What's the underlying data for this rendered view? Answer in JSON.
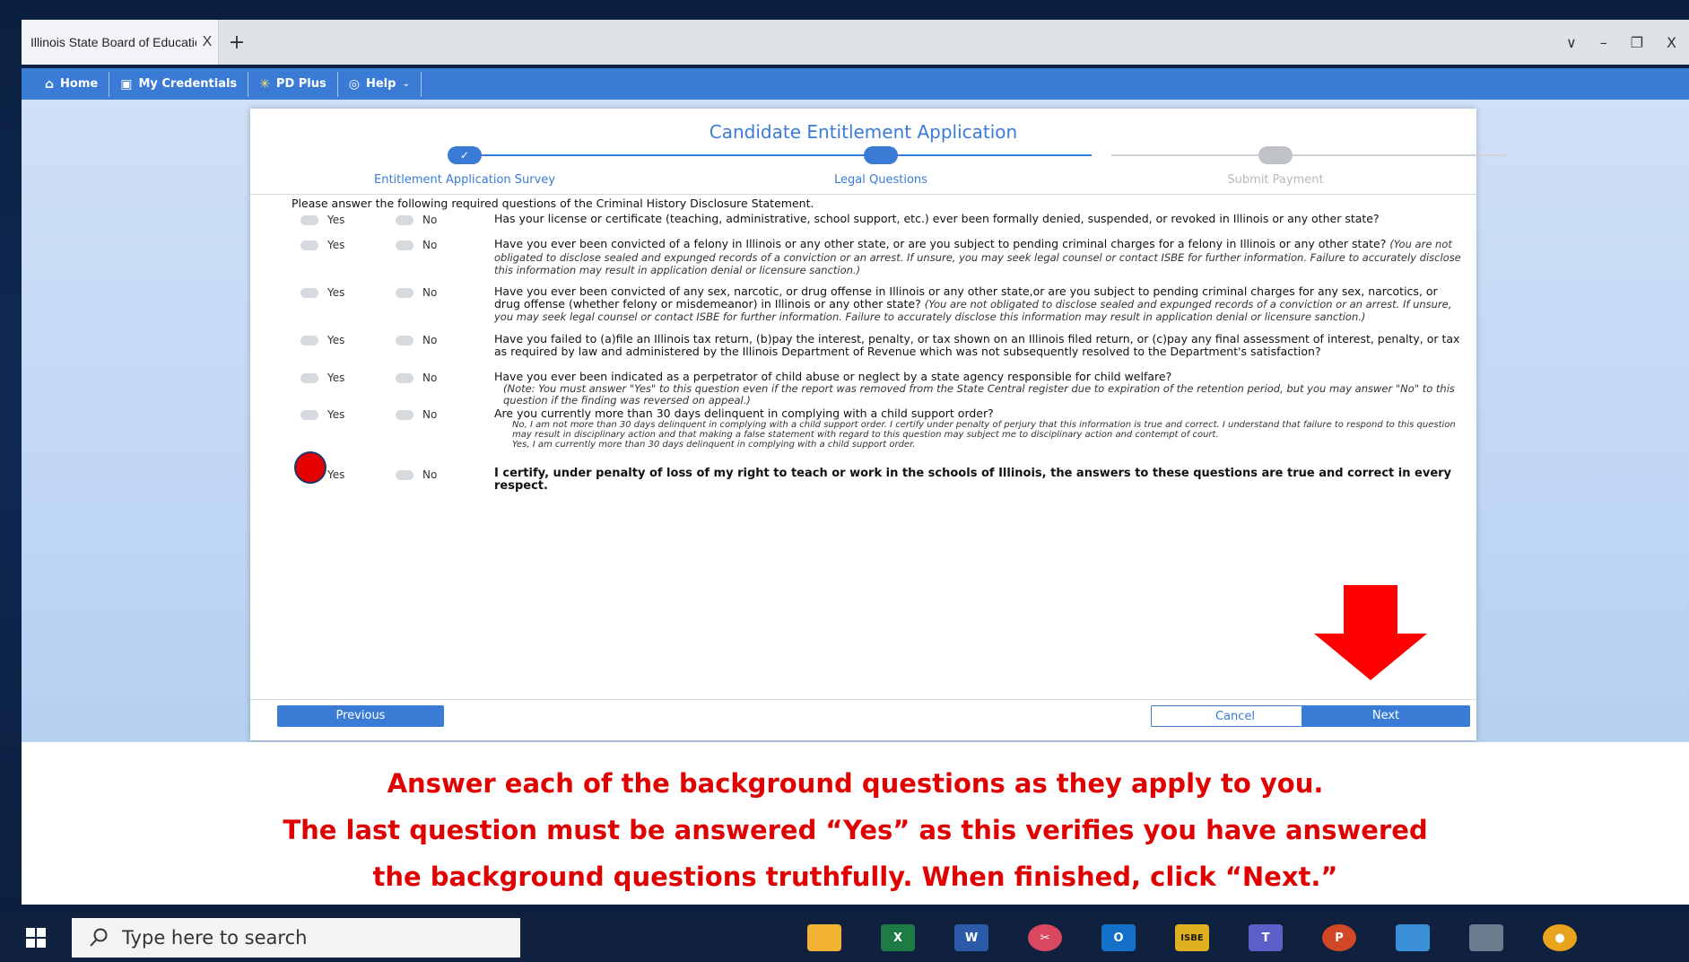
{
  "browser": {
    "tab_title": "Illinois State Board of Education",
    "tab_close": "X",
    "new_tab": "+",
    "win_chevron": "∨",
    "win_minimize": "–",
    "win_restore": "❐",
    "win_close": "X"
  },
  "nav": {
    "items": [
      {
        "label": "Home",
        "icon": "home-icon"
      },
      {
        "label": "My Credentials",
        "icon": "credentials-icon"
      },
      {
        "label": "PD Plus",
        "icon": "pd-plus-icon"
      },
      {
        "label": "Help",
        "icon": "help-icon"
      }
    ]
  },
  "card": {
    "title": "Candidate Entitlement Application",
    "steps": [
      {
        "label": "Entitlement Application Survey",
        "state": "complete"
      },
      {
        "label": "Legal Questions",
        "state": "current"
      },
      {
        "label": "Submit Payment",
        "state": "pending"
      }
    ],
    "intro": "Please answer the following required questions of the Criminal History Disclosure Statement.",
    "yes_label": "Yes",
    "no_label": "No",
    "questions": [
      {
        "text": "Has your license or certificate (teaching, administrative, school support, etc.) ever been formally denied, suspended, or revoked in Illinois or any other state?"
      },
      {
        "text": "Have you ever been convicted of a felony in Illinois or any other state, or are you subject to pending criminal charges for a felony in Illinois or any other state?",
        "note": "(You are not obligated to disclose sealed and expunged records of a conviction or an arrest. If unsure, you may seek legal counsel or contact ISBE for further information. Failure to accurately disclose this information may result in application denial or licensure sanction.)"
      },
      {
        "text": "Have you ever been convicted of any sex, narcotic, or drug offense in Illinois or any other state,or are you subject to pending criminal charges for any sex, narcotics, or drug offense (whether felony or misdemeanor) in Illinois or any other state?",
        "note": "(You are not obligated to disclose sealed and expunged records of a conviction or an arrest. If unsure, you may seek legal counsel or contact ISBE for further information. Failure to accurately disclose this information may result in application denial or licensure sanction.)"
      },
      {
        "text": "Have you failed to (a)file an Illinois tax return, (b)pay the interest, penalty, or tax shown on an Illinois filed return, or (c)pay any final assessment of interest, penalty, or tax as required by law and administered by the Illinois Department of Revenue which was not subsequently resolved to the Department's satisfaction?"
      },
      {
        "text": "Have you ever been indicated as a perpetrator of child abuse or neglect by a state agency responsible for child welfare?",
        "note": "(Note: You must answer \"Yes\" to this question even if the report was removed from the State Central register due to expiration of the retention period, but you may answer \"No\" to this question if the finding was reversed on appeal.)"
      },
      {
        "text": "Are you currently more than 30 days delinquent in complying with a child support order?",
        "subnotes": [
          "No, I am not more than 30 days delinquent in complying with a child support order. I certify under penalty of perjury that this information is true and correct. I understand that failure to respond to this question may result in disciplinary action and that making a false statement with regard to this question may subject me to disciplinary action and contempt of court.",
          "Yes, I am currently more than 30 days delinquent in complying with a child support order."
        ]
      },
      {
        "text": "I certify, under penalty of loss of my right to teach or work in the schools of Illinois, the answers to these questions are true and correct in every respect."
      }
    ],
    "buttons": {
      "previous": "Previous",
      "cancel": "Cancel",
      "next": "Next"
    }
  },
  "instructions": {
    "line1": "Answer each of the background questions as they apply to you.",
    "line2": "The last question must be answered “Yes” as this verifies you have answered",
    "line3": "the background questions truthfully.   When finished, click “Next.”"
  },
  "taskbar": {
    "search_placeholder": "Type here to search",
    "apps": [
      "file-explorer-icon",
      "excel-icon",
      "word-icon",
      "snipping-tool-icon",
      "outlook-icon",
      "isbe-icon",
      "teams-icon",
      "powerpoint-icon",
      "remote-desktop-icon",
      "calculator-icon",
      "chrome-icon"
    ],
    "isbe_label": "ISBE"
  },
  "colors": {
    "accent": "#3a7bd5",
    "highlight": "#e50000"
  }
}
